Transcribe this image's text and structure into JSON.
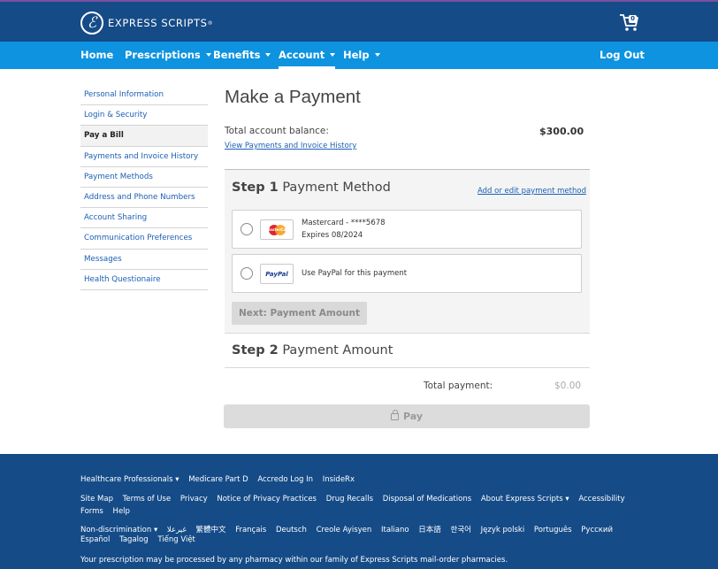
{
  "header": {
    "brand": "EXPRESS SCRIPTS",
    "brand_symbol": "ℰ",
    "brand_registered": "®",
    "cart_count": "0"
  },
  "nav": {
    "home": "Home",
    "prescriptions": "Prescriptions",
    "benefits": "Benefits",
    "account": "Account",
    "help": "Help",
    "logout": "Log Out"
  },
  "sidebar": {
    "items": [
      "Personal Information",
      "Login & Security",
      "Pay a Bill",
      "Payments and Invoice History",
      "Payment Methods",
      "Address and Phone Numbers",
      "Account Sharing",
      "Communication Preferences",
      "Messages",
      "Health Questionaire"
    ],
    "active_index": 2
  },
  "main": {
    "title": "Make a Payment",
    "balance_label": "Total account balance:",
    "balance_amount": "$300.00",
    "history_link": "View Payments and Invoice History"
  },
  "step1": {
    "step_label": "Step 1",
    "title": "Payment Method",
    "edit_link": "Add or edit payment method",
    "card_line1": "Mastercard - ****5678",
    "card_line2": "Expires 08/2024",
    "card_logo_text": "MasterCard",
    "paypal_logo_text": "PayPal",
    "paypal_line": "Use PayPal for this payment",
    "next_button": "Next: Payment Amount"
  },
  "step2": {
    "step_label": "Step 2",
    "title": "Payment Amount",
    "total_label": "Total payment:",
    "total_amount": "$0.00",
    "pay_button": "Pay"
  },
  "footer": {
    "row1": [
      "Healthcare Professionals ▾",
      "Medicare Part D",
      "Accredo Log In",
      "InsideRx"
    ],
    "row2": [
      "Site Map",
      "Terms of Use",
      "Privacy",
      "Notice of Privacy Practices",
      "Drug Recalls",
      "Disposal of Medications",
      "About Express Scripts ▾",
      "Accessibility"
    ],
    "row3": [
      "Forms",
      "Help"
    ],
    "row4": [
      "Non-discrimination ▾",
      "غيرعلا",
      "繁體中文",
      "Français",
      "Deutsch",
      "Creole Ayisyen",
      "Italiano",
      "日本語",
      "한국어",
      "Język polski",
      "Português",
      "Русский"
    ],
    "row5": [
      "Español",
      "Tagalog",
      "Tiếng Việt"
    ],
    "notice": "Your prescription may be processed by any pharmacy within our family of Express Scripts mail-order pharmacies."
  },
  "colors": {
    "header_bg": "#154b87",
    "nav_bg": "#0d93e0",
    "link": "#1b5fb4",
    "footer_bg": "#154b87"
  }
}
